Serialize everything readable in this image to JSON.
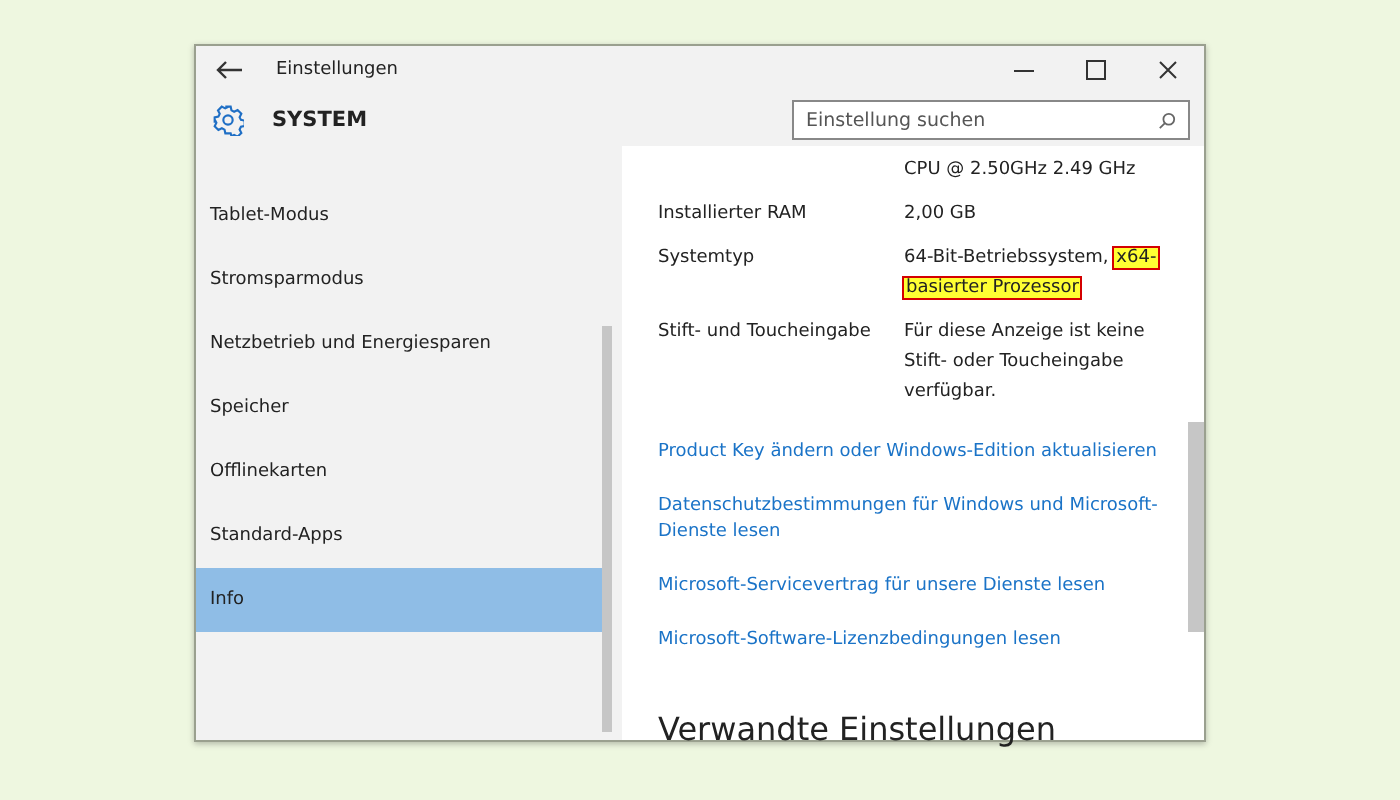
{
  "window": {
    "title": "Einstellungen"
  },
  "header": {
    "title": "SYSTEM",
    "search": {
      "placeholder": "Einstellung suchen"
    }
  },
  "sidebar": {
    "items": [
      {
        "label": "Tablet-Modus",
        "selected": false
      },
      {
        "label": "Stromsparmodus",
        "selected": false
      },
      {
        "label": "Netzbetrieb und Energiesparen",
        "selected": false
      },
      {
        "label": "Speicher",
        "selected": false
      },
      {
        "label": "Offlinekarten",
        "selected": false
      },
      {
        "label": "Standard-Apps",
        "selected": false
      },
      {
        "label": "Info",
        "selected": true
      }
    ]
  },
  "content": {
    "properties": [
      {
        "value": "CPU @ 2.50GHz   2.49 GHz"
      },
      {
        "label": "Installierter RAM",
        "value": "2,00 GB"
      },
      {
        "label": "Systemtyp",
        "value": "64-Bit-Betriebssystem,",
        "highlight": [
          "x64-",
          "basierter Prozessor"
        ]
      },
      {
        "label": "Stift- und Toucheingabe",
        "value": "Für diese Anzeige ist keine Stift- oder Toucheingabe verfügbar."
      }
    ],
    "links": [
      "Product Key ändern oder Windows-Edition aktualisieren",
      "Datenschutzbestimmungen für Windows und Microsoft-Dienste lesen",
      "Microsoft-Servicevertrag für unsere Dienste lesen",
      "Microsoft-Software-Lizenzbedingungen lesen"
    ],
    "section_heading": "Verwandte Einstellungen"
  }
}
